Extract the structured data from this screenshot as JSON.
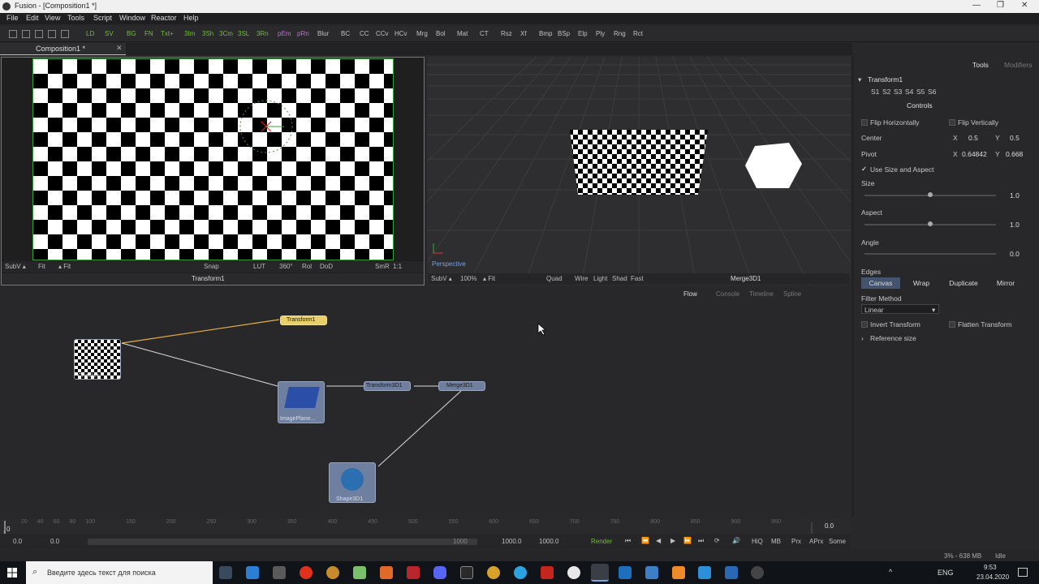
{
  "window": {
    "title": "Fusion - [Composition1 *]",
    "minimize": "—",
    "maximize": "❒",
    "close": "✕"
  },
  "menu": [
    "File",
    "Edit",
    "View",
    "Tools",
    "Script",
    "Window",
    "Reactor",
    "Help"
  ],
  "toolbar": [
    "LD",
    "SV",
    "BG",
    "FN",
    "Txt+",
    "3Im",
    "3Sh",
    "3Cm",
    "3SL",
    "3Rn",
    "pEm",
    "pRn",
    "Blur",
    "BC",
    "CC",
    "CCv",
    "HCv",
    "Mrg",
    "Bol",
    "Mat",
    "CT",
    "Rsz",
    "Xf",
    "Bmp",
    "BSp",
    "Elp",
    "Ply",
    "Rng",
    "Rct"
  ],
  "tab": {
    "label": "Composition1 *",
    "close": "✕"
  },
  "viewer1": {
    "controls": [
      "SubV ▴",
      "Fit",
      "▴ Fit",
      "Snap",
      "LUT",
      "360°",
      "Rol",
      "DoD",
      "SmR",
      "1:1"
    ],
    "label": "Transform1"
  },
  "viewer2": {
    "camera": "Perspective",
    "controls": [
      "SubV ▴",
      "100%",
      "▴ Fit",
      "Quad",
      "Wire",
      "Light",
      "Shad",
      "Fast"
    ],
    "label": "Merge3D1"
  },
  "flow_tabs": [
    "Flow",
    "Console",
    "Timeline",
    "Spline"
  ],
  "nodes": {
    "checker": "Checker",
    "transform1": "Transform1",
    "imageplane": "ImagePlane...",
    "transform3d": "Transform3D1",
    "merge3d": "Merge3D1",
    "shape3d": "Shape3D1"
  },
  "inspector": {
    "tabs": [
      "Tools",
      "Modifiers"
    ],
    "tool_name": "Transform1",
    "slots": [
      "S1",
      "S2",
      "S3",
      "S4",
      "S5",
      "S6"
    ],
    "section": "Controls",
    "flip_h": "Flip Horizontally",
    "flip_v": "Flip Vertically",
    "center_label": "Center",
    "center_x": "0.5",
    "center_y": "0.5",
    "pivot_label": "Pivot",
    "pivot_x": "0.64842",
    "pivot_y": "0.668",
    "x": "X",
    "y": "Y",
    "use_size": "Use Size and Aspect",
    "size_label": "Size",
    "size_val": "1.0",
    "size_level": 0.5,
    "aspect_label": "Aspect",
    "aspect_val": "1.0",
    "aspect_level": 0.5,
    "angle_label": "Angle",
    "angle_val": "0.0",
    "edges_label": "Edges",
    "edges": [
      "Canvas",
      "Wrap",
      "Duplicate",
      "Mirror"
    ],
    "filter_label": "Filter Method",
    "filter_val": "Linear",
    "invert": "Invert Transform",
    "flatten": "Flatten Transform",
    "refsize": "Reference size"
  },
  "timeline": {
    "ticks": [
      "0",
      "20",
      "40",
      "60",
      "80",
      "100",
      "150",
      "200",
      "250",
      "300",
      "350",
      "400",
      "450",
      "500",
      "550",
      "600",
      "650",
      "700",
      "750",
      "800",
      "850",
      "900",
      "950"
    ],
    "current": "0.0",
    "frame_start": "0",
    "start": "0.0",
    "start2": "0.0",
    "range_end": "1000",
    "end": "1000.0",
    "end2": "1000.0",
    "render": "Render",
    "hiq": "HiQ",
    "mb": "MB",
    "prx": "Prx",
    "aprx": "APrx",
    "some": "Some"
  },
  "status": {
    "memory": "3% - 638 MB",
    "state": "Idle"
  },
  "taskbar": {
    "search_placeholder": "Введите здесь текст для поиска",
    "lang": "ENG",
    "time": "9:53",
    "date": "23.04.2020"
  },
  "colors": {
    "accent_yellow": "#ddc04c",
    "node_blue": "#6e7fa0",
    "selected_node": "#e8cf6a",
    "green_text": "#6fbf3a"
  }
}
